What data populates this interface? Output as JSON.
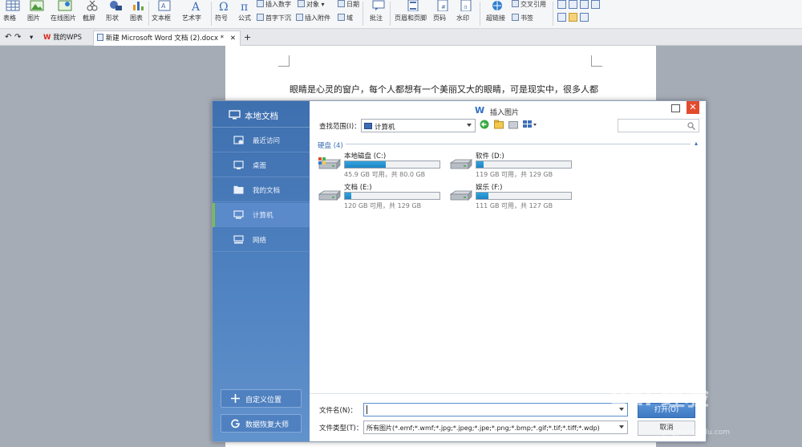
{
  "ribbon": {
    "items": [
      {
        "label": "表格",
        "icon": "table-icon"
      },
      {
        "label": "图片",
        "icon": "picture-icon"
      },
      {
        "label": "在线图片",
        "icon": "online-picture-icon"
      },
      {
        "label": "截屏",
        "icon": "screenshot-icon"
      },
      {
        "label": "形状",
        "icon": "shapes-icon"
      },
      {
        "label": "图表",
        "icon": "chart-icon"
      },
      {
        "label": "文本框",
        "icon": "textbox-icon"
      },
      {
        "label": "艺术字",
        "icon": "wordart-icon"
      },
      {
        "label": "符号",
        "icon": "symbol-icon"
      },
      {
        "label": "公式",
        "icon": "formula-icon"
      },
      {
        "label": "批注",
        "icon": "comment-icon"
      },
      {
        "label": "页眉和页脚",
        "icon": "header-footer-icon"
      },
      {
        "label": "页码",
        "icon": "page-number-icon"
      },
      {
        "label": "水印",
        "icon": "watermark-icon"
      },
      {
        "label": "超链接",
        "icon": "hyperlink-icon"
      }
    ],
    "small": {
      "insert_number": "插入数字",
      "object": "对象",
      "date": "日期",
      "dropcap": "首字下沉",
      "attachment": "插入附件",
      "field": "域",
      "cross_ref": "交叉引用",
      "bookmark": "书签"
    }
  },
  "tabs": {
    "my_wps": "我的WPS",
    "document": "新建 Microsoft Word 文档 (2).docx *",
    "add": "+"
  },
  "document": {
    "text": "眼睛是心灵的窗户，每个人都想有一个美丽又大的眼睛，可是现实中，很多人都"
  },
  "dialog": {
    "title": "插入图片",
    "sidebar": {
      "title": "本地文档",
      "items": [
        {
          "label": "最近访问",
          "icon": "recent-icon",
          "selected": false
        },
        {
          "label": "桌面",
          "icon": "desktop-icon",
          "selected": false
        },
        {
          "label": "我的文档",
          "icon": "folder-icon",
          "selected": false
        },
        {
          "label": "计算机",
          "icon": "computer-icon",
          "selected": true
        },
        {
          "label": "网络",
          "icon": "network-icon",
          "selected": false
        }
      ],
      "custom_location": "自定义位置",
      "recovery": "数据恢复大师"
    },
    "look_in_label": "查找范围(I)：",
    "look_in_value": "计算机",
    "search_placeholder": "",
    "section_title": "硬盘 (4)",
    "drives": [
      {
        "name": "本地磁盘 (C:)",
        "info": "45.9 GB 可用，共 80.0 GB",
        "used_fraction": 0.43,
        "system": true
      },
      {
        "name": "软件 (D:)",
        "info": "119 GB 可用，共 129 GB",
        "used_fraction": 0.08,
        "system": false
      },
      {
        "name": "文档 (E:)",
        "info": "120 GB 可用，共 129 GB",
        "used_fraction": 0.07,
        "system": false
      },
      {
        "name": "娱乐 (F:)",
        "info": "111 GB 可用，共 127 GB",
        "used_fraction": 0.13,
        "system": false
      }
    ],
    "file_name_label": "文件名(N)：",
    "file_name_value": "",
    "file_type_label": "文件类型(T)：",
    "file_type_value": "所有图片(*.emf;*.wmf;*.jpg;*.jpeg;*.jpe;*.png;*.bmp;*.gif;*.tif;*.tiff;*.wdp)",
    "open_button": "打开(O)",
    "cancel_button": "取消",
    "close_glyph": "✕"
  },
  "watermark": {
    "text": "Bai 经验",
    "sub": "jingyan.baidu.com"
  },
  "colors": {
    "sidebar_blue": "#4a7dbd",
    "selected_accent": "#79c04a",
    "progress_blue": "#1e84c4",
    "close_red": "#e24b2d"
  }
}
